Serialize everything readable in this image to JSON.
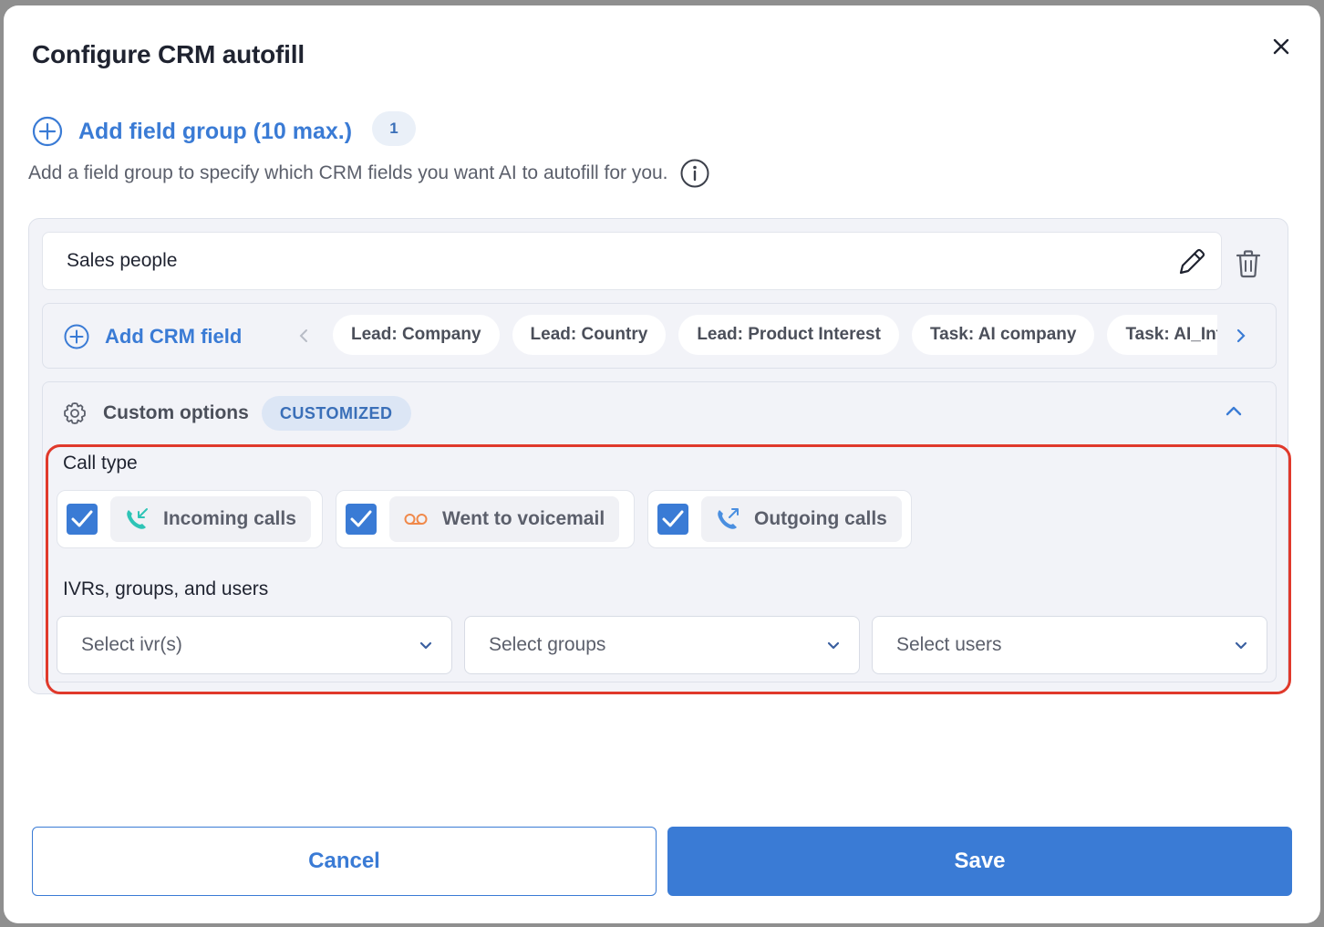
{
  "modal": {
    "title": "Configure CRM autofill"
  },
  "field_group": {
    "add_label": "Add field group (10 max.)",
    "count": "1",
    "helper_text": "Add a field group to specify which CRM fields you want AI to autofill for you."
  },
  "group": {
    "name": "Sales people",
    "add_crm_label": "Add CRM field",
    "crm_fields": [
      "Lead: Company",
      "Lead: Country",
      "Lead: Product Interest",
      "Task: AI company",
      "Task: AI_Interest"
    ]
  },
  "custom_options": {
    "title": "Custom options",
    "badge": "CUSTOMIZED",
    "call_type_label": "Call type",
    "call_types": [
      {
        "label": "Incoming calls",
        "checked": true,
        "icon": "incoming-call-icon",
        "color": "#2ec4b6"
      },
      {
        "label": "Went to voicemail",
        "checked": true,
        "icon": "voicemail-icon",
        "color": "#f0894a"
      },
      {
        "label": "Outgoing calls",
        "checked": true,
        "icon": "outgoing-call-icon",
        "color": "#4a8fe0"
      }
    ],
    "ivr_label": "IVRs, groups, and users",
    "selects": [
      {
        "placeholder": "Select ivr(s)"
      },
      {
        "placeholder": "Select groups"
      },
      {
        "placeholder": "Select users"
      }
    ]
  },
  "footer": {
    "cancel_label": "Cancel",
    "save_label": "Save"
  },
  "colors": {
    "accent": "#3a7bd5",
    "highlight": "#e0392b"
  }
}
